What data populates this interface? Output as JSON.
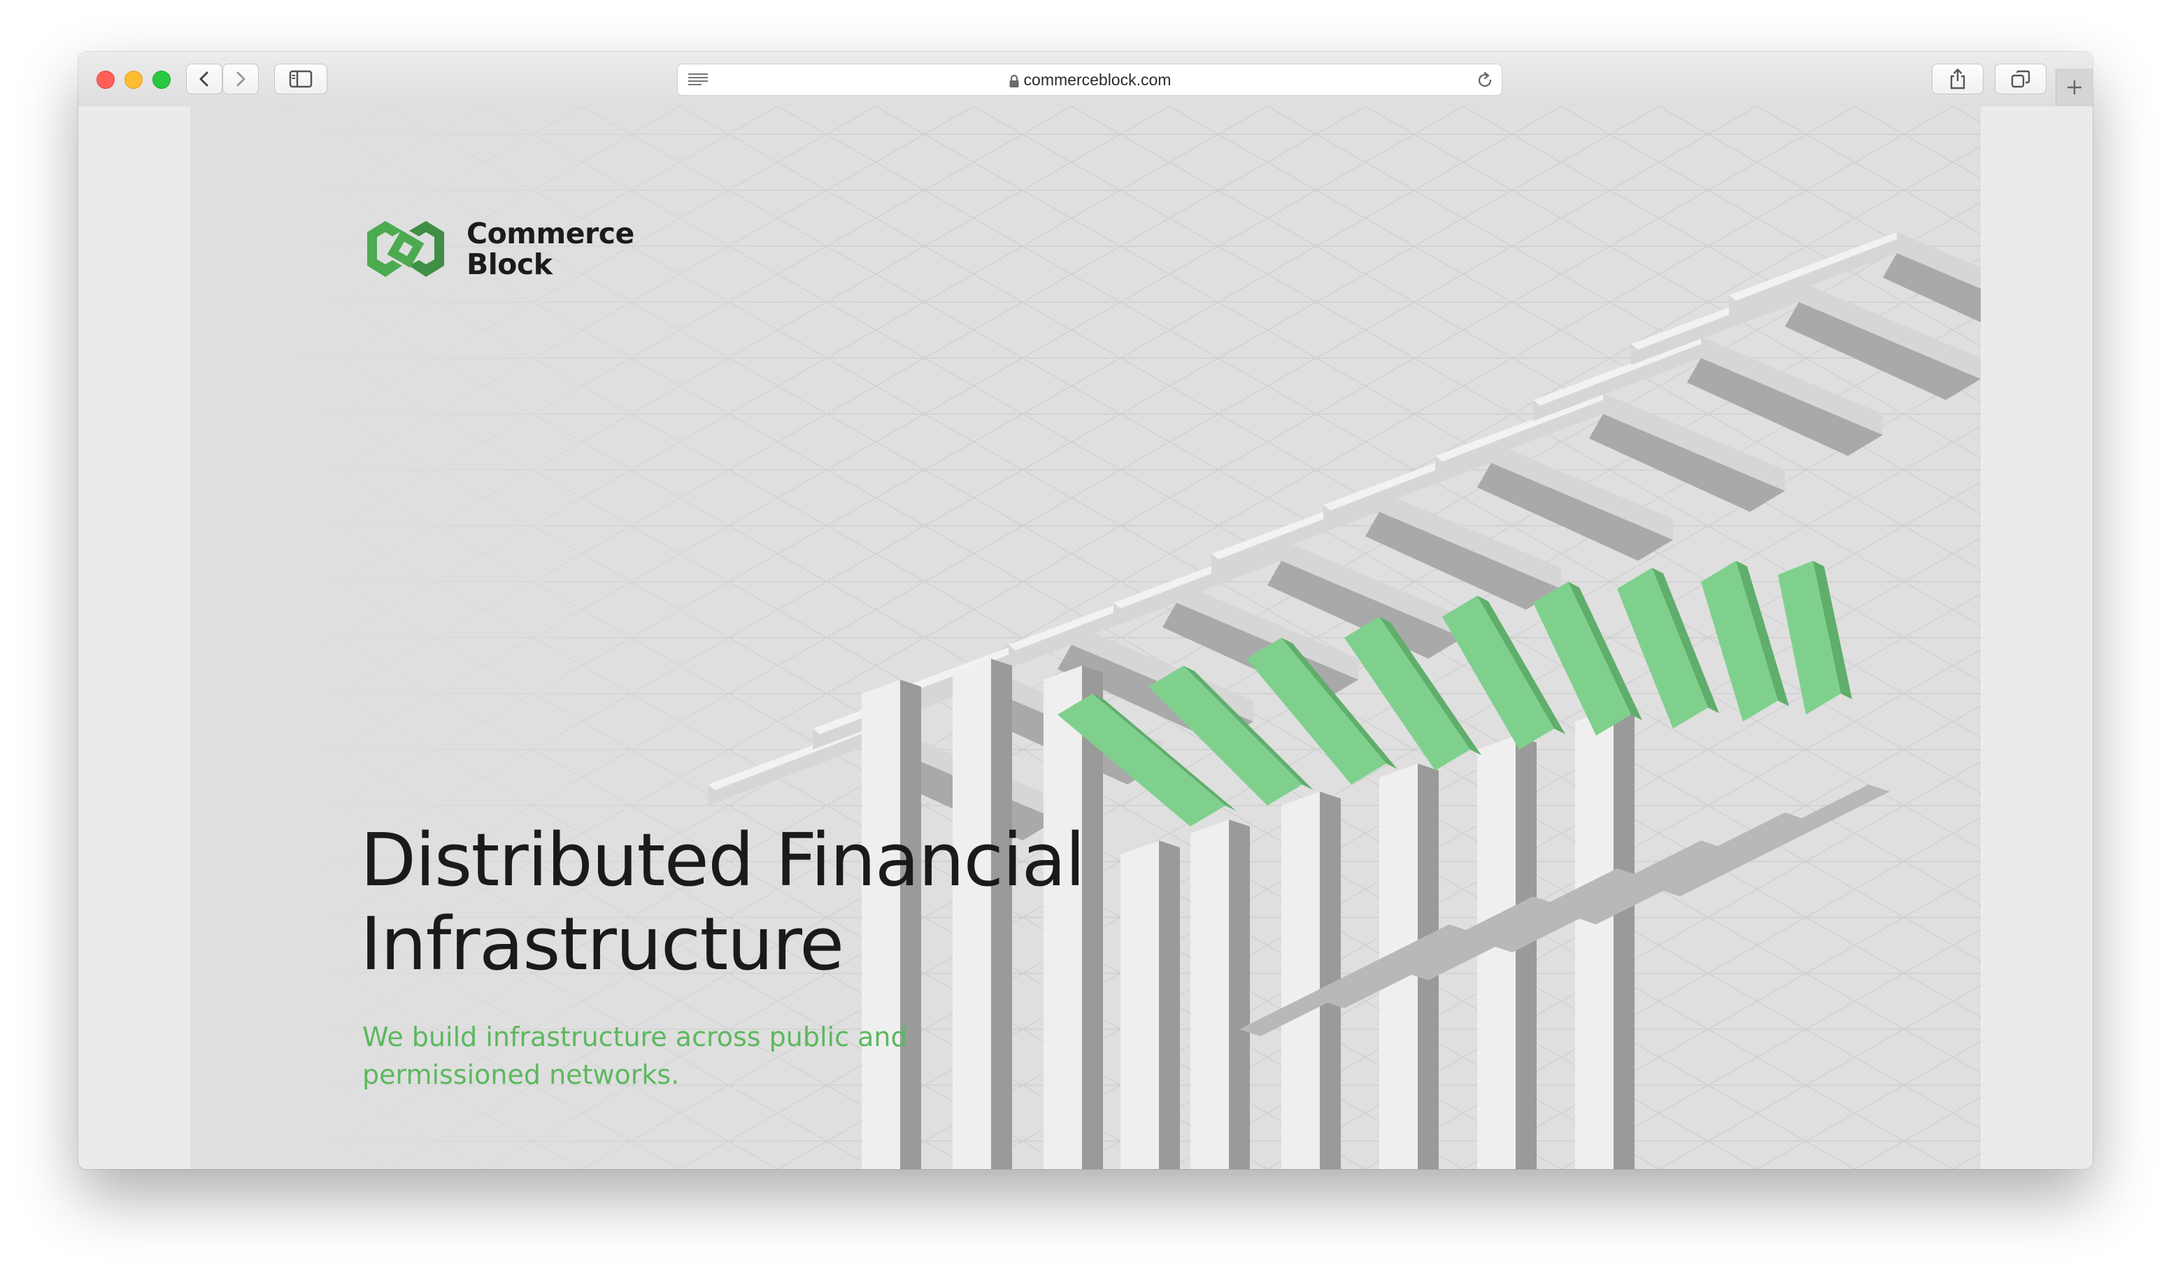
{
  "browser": {
    "url": "commerceblock.com",
    "buttons": {
      "back": "chevron-left-icon",
      "forward": "chevron-right-icon",
      "sidebar": "sidebar-icon",
      "reader": "reader-icon",
      "reload": "reload-icon",
      "share": "share-icon",
      "tabs": "tabs-icon",
      "new_tab": "plus-icon"
    }
  },
  "page": {
    "logo": {
      "line1": "Commerce",
      "line2": "Block",
      "mark_color": "#4caa50"
    },
    "headline": {
      "line1": "Distributed Financial",
      "line2": "Infrastructure"
    },
    "subheadline": {
      "line1": "We build infrastructure across public and",
      "line2": "permissioned networks."
    },
    "colors": {
      "accent_green": "#5cb85f",
      "bar_green": "#7fd08d",
      "background": "#dfdfdf",
      "text": "#1a1a1a"
    }
  }
}
